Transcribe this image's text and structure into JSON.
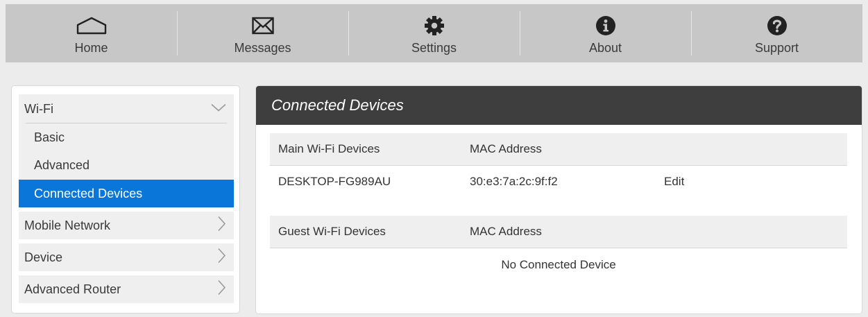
{
  "nav": {
    "home": {
      "label": "Home",
      "icon": "home-icon"
    },
    "messages": {
      "label": "Messages",
      "icon": "envelope-icon"
    },
    "settings": {
      "label": "Settings",
      "icon": "gear-icon"
    },
    "about": {
      "label": "About",
      "icon": "info-icon"
    },
    "support": {
      "label": "Support",
      "icon": "help-icon"
    }
  },
  "sidebar": {
    "wifi": {
      "label": "Wi-Fi",
      "expanded": true
    },
    "wifi_items": [
      {
        "label": "Basic"
      },
      {
        "label": "Advanced"
      },
      {
        "label": "Connected Devices",
        "selected": true
      }
    ],
    "sections": [
      {
        "label": "Mobile Network"
      },
      {
        "label": "Device"
      },
      {
        "label": "Advanced Router"
      }
    ]
  },
  "panel": {
    "title": "Connected Devices",
    "main_wifi": {
      "col_device": "Main Wi-Fi Devices",
      "col_mac": "MAC Address",
      "rows": [
        {
          "device": "DESKTOP-FG989AU",
          "mac": "30:e3:7a:2c:9f:f2",
          "action": "Edit"
        }
      ]
    },
    "guest_wifi": {
      "col_device": "Guest Wi-Fi Devices",
      "col_mac": "MAC Address",
      "empty_text": "No Connected Device"
    }
  },
  "colors": {
    "nav_bg": "#c7c7c7",
    "selected_bg": "#0b76da",
    "panel_header_bg": "#3e3e3e"
  }
}
